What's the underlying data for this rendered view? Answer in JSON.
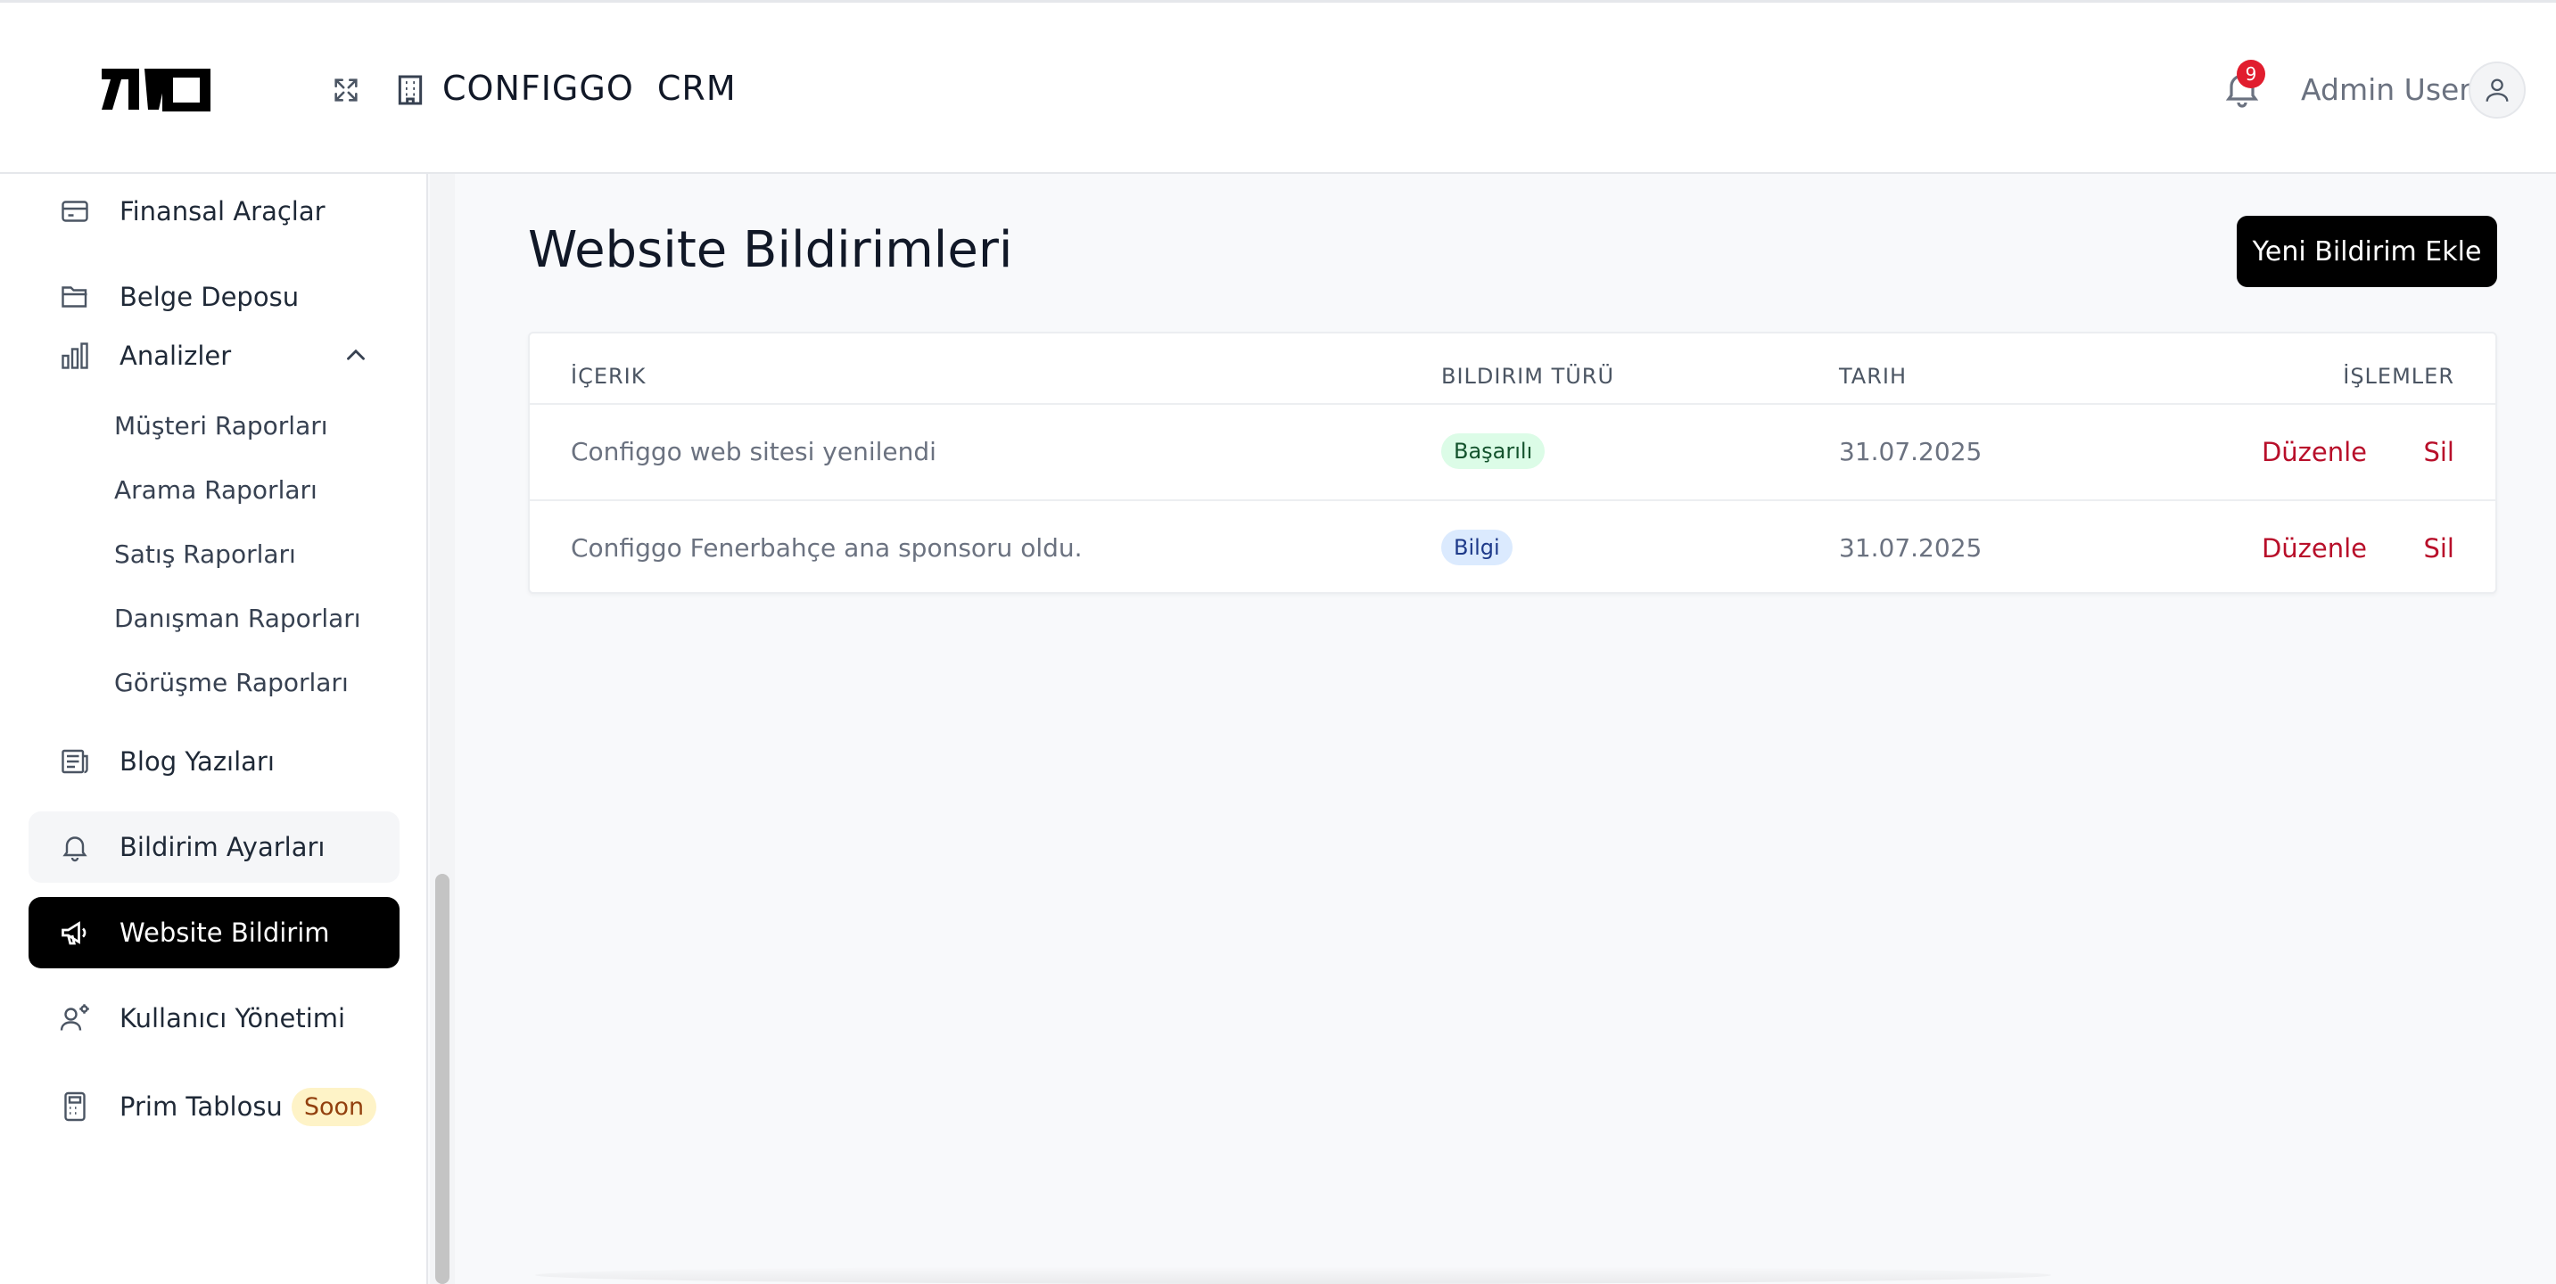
{
  "header": {
    "app_title": "CONFIGGO  CRM",
    "notification_count": "9",
    "user_name": "Admin User",
    "icons": {
      "expand": "expand-icon",
      "org": "building-icon",
      "bell": "bell-icon",
      "avatar": "user-icon"
    }
  },
  "sidebar": {
    "items": [
      {
        "label": "Finansal Araçlar",
        "icon": "credit-card-icon"
      },
      {
        "label": "Belge Deposu",
        "icon": "folder-icon"
      },
      {
        "label": "Analizler",
        "icon": "bar-chart-icon"
      },
      {
        "label": "Blog Yazıları",
        "icon": "newspaper-icon"
      },
      {
        "label": "Bildirim Ayarları",
        "icon": "bell-icon"
      },
      {
        "label": "Website Bildirim",
        "icon": "megaphone-icon"
      },
      {
        "label": "Kullanıcı Yönetimi",
        "icon": "users-cog-icon"
      },
      {
        "label": "Prim Tablosu",
        "icon": "calculator-icon",
        "badge": "Soon"
      }
    ],
    "analytics_subitems": [
      "Müşteri Raporları",
      "Arama Raporları",
      "Satış Raporları",
      "Danışman Raporları",
      "Görüşme Raporları"
    ],
    "active_item": "Website Bildirim"
  },
  "main": {
    "page_title": "Website Bildirimleri",
    "add_button_label": "Yeni Bildirim Ekle",
    "table": {
      "headers": [
        "İÇERIK",
        "BILDIRIM TÜRÜ",
        "TARIH",
        "İŞLEMLER"
      ],
      "rows": [
        {
          "content": "Configgo web sitesi yenilendi",
          "type": "Başarılı",
          "type_kind": "success",
          "date": "31.07.2025",
          "edit_label": "Düzenle",
          "delete_label": "Sil"
        },
        {
          "content": "Configgo Fenerbahçe ana sponsoru oldu.",
          "type": "Bilgi",
          "type_kind": "info",
          "date": "31.07.2025",
          "edit_label": "Düzenle",
          "delete_label": "Sil"
        }
      ]
    }
  },
  "colors": {
    "accent": "#000000",
    "danger_link": "#b80f2a",
    "badge_success_bg": "#dcfce7",
    "badge_info_bg": "#dbeafe",
    "notification_badge": "#e11d2e",
    "soon_badge_bg": "#fef3c7"
  }
}
